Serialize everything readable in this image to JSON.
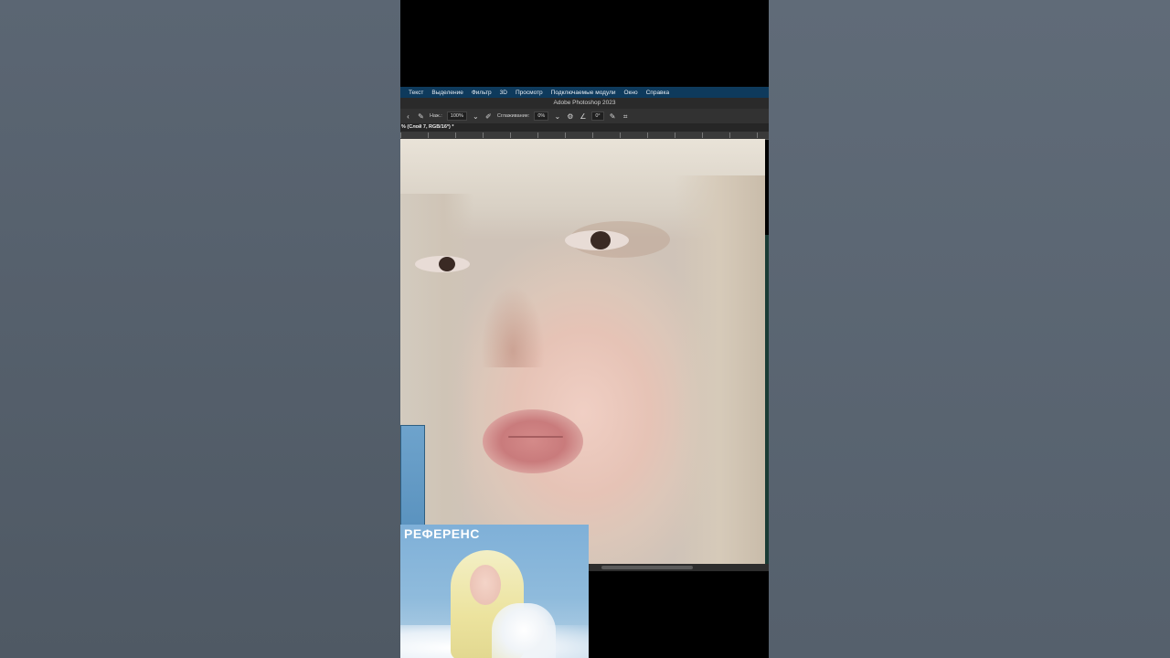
{
  "menubar": {
    "items": [
      "Текст",
      "Выделение",
      "Фильтр",
      "3D",
      "Просмотр",
      "Подключаемые модули",
      "Окно",
      "Справка"
    ]
  },
  "window": {
    "title": "Adobe Photoshop 2023"
  },
  "options": {
    "opacity_label": "Наж.:",
    "opacity_value": "100%",
    "smoothing_label": "Сглаживание:",
    "smoothing_value": "0%",
    "angle_value": "0°"
  },
  "document": {
    "tab_label": "% (Слой 7, RGB/16*) *"
  },
  "reference": {
    "label": "РЕФЕРЕНС"
  },
  "colors": {
    "menubar": "#0e3a5c",
    "canvas_skin": "#e6c3b6",
    "reference_sky": "#7fb0d8"
  },
  "icons": [
    "brush-icon",
    "pressure-icon",
    "settings-gear-icon",
    "angle-icon",
    "symmetry-icon",
    "butterfly-icon"
  ]
}
